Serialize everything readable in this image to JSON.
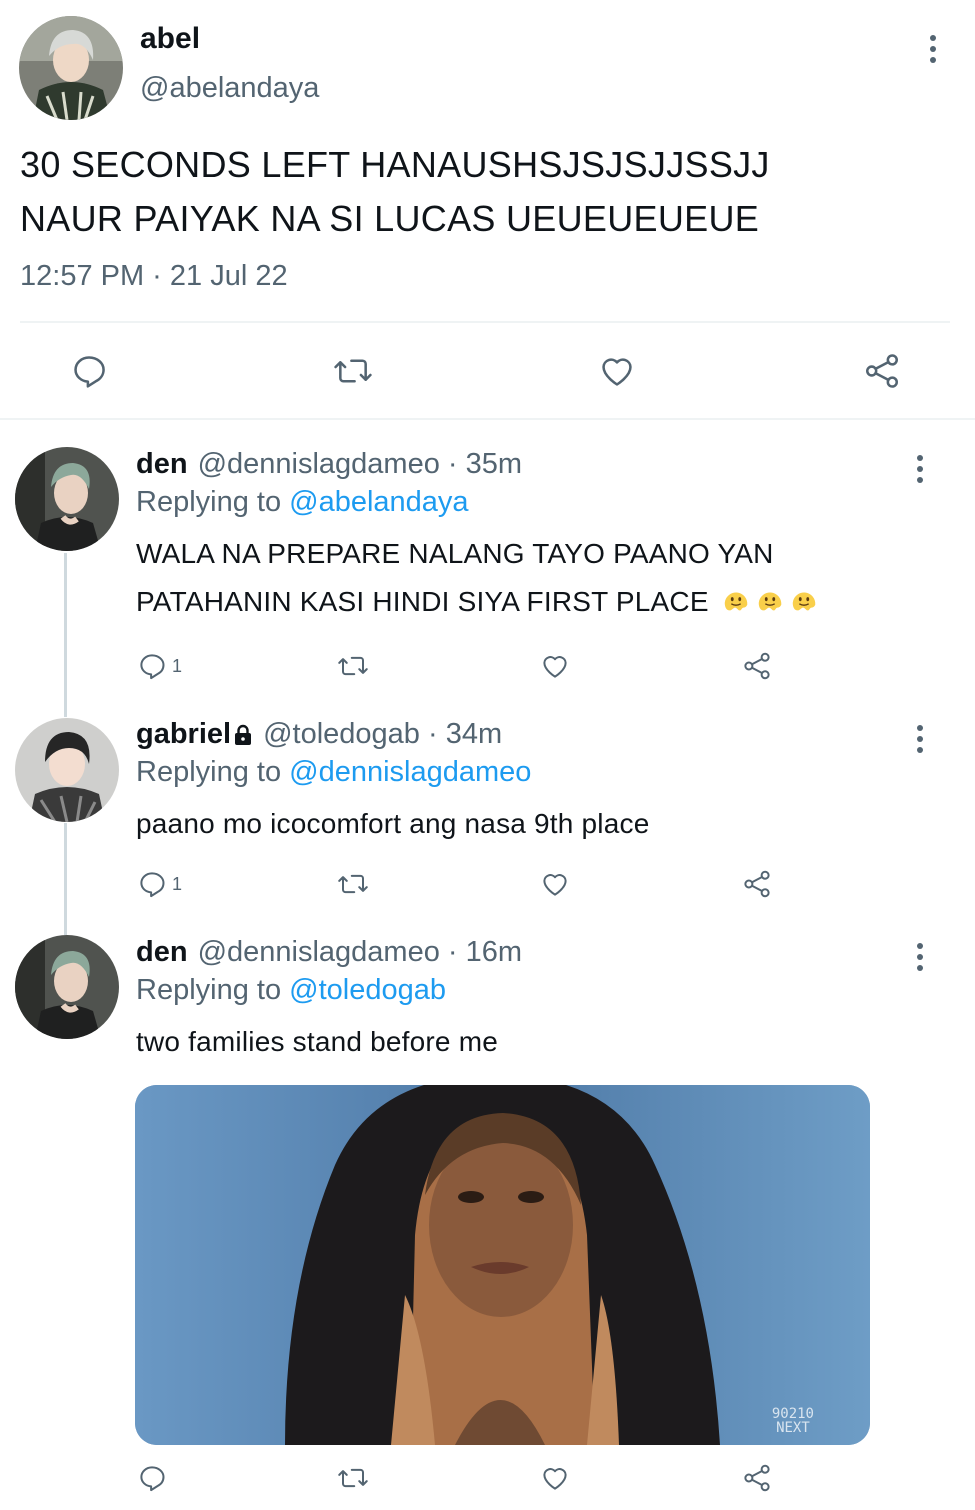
{
  "colors": {
    "accent": "#1d9bf0",
    "secondary_text": "#536471",
    "primary_text": "#0f1419",
    "divider": "#eff3f4"
  },
  "main_tweet": {
    "name": "abel",
    "handle": "@abelandaya",
    "text_lines": [
      "30 SECONDS LEFT HANAUSHSJSJSJJSSJJ",
      "NAUR PAIYAK NA SI LUCAS UEUEUEUEUE"
    ],
    "time": "12:57 PM · 21 Jul 22",
    "actions": [
      "reply-icon",
      "retweet-icon",
      "like-icon",
      "share-icon"
    ]
  },
  "replies": [
    {
      "name": "den",
      "handle_time": "@dennislagdameo · 35m",
      "replying_prefix": "Replying to",
      "replying_to": "@abelandaya",
      "text_lines": [
        "WALA NA PREPARE NALANG TAYO PAANO YAN",
        "PATAHANIN KASI HINDI SIYA FIRST PLACE"
      ],
      "emojis": [
        "melting-face-emoji",
        "melting-face-emoji",
        "melting-face-emoji"
      ],
      "reply_count": "1"
    },
    {
      "name": "gabriel",
      "protected_icon": "lock-icon",
      "handle_time": "@toledogab · 34m",
      "replying_prefix": "Replying to",
      "replying_to": "@dennislagdameo",
      "text_lines": [
        "paano mo icocomfort ang nasa 9th place"
      ],
      "reply_count": "1"
    },
    {
      "name": "den",
      "handle_time": "@dennislagdameo · 16m",
      "replying_prefix": "Replying to",
      "replying_to": "@toledogab",
      "text_lines": [
        "two families stand before me"
      ],
      "media_watermark": [
        "90210",
        "NEXT"
      ]
    }
  ]
}
